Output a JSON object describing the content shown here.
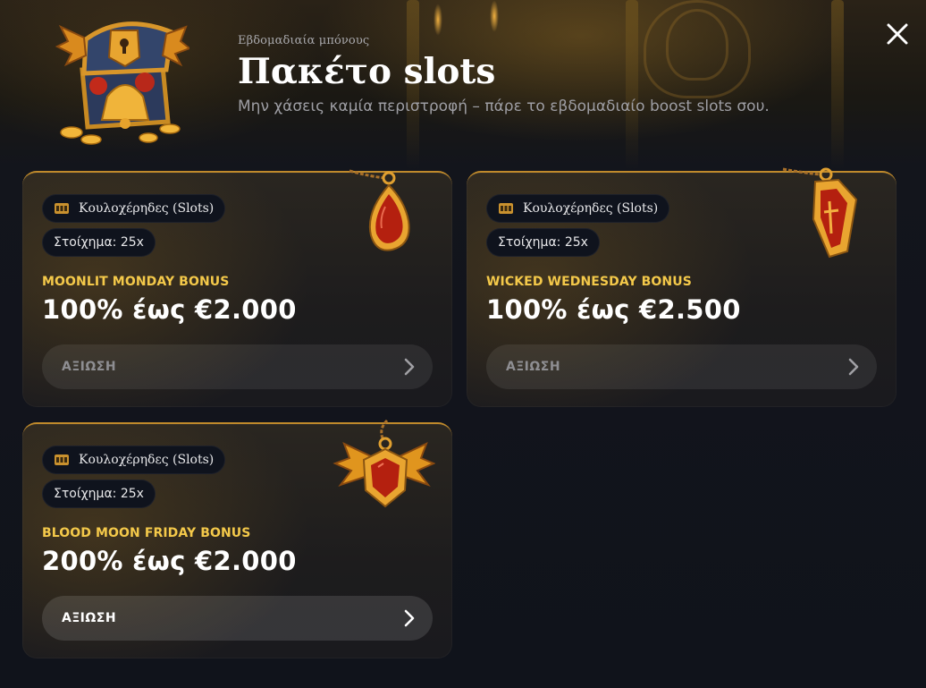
{
  "header": {
    "eyebrow": "Εβδομαδιαία μπόνους",
    "title": "Πακέτο slots",
    "subtitle": "Μην χάσεις καμία περιστροφή – πάρε το εβδομαδιαίο boost slots σου."
  },
  "icons": {
    "close": "close-icon",
    "chest": "treasure-chest-icon",
    "slot": "slot-machine-icon",
    "chevron": "chevron-right-icon"
  },
  "colors": {
    "accent_gold": "#f4c94a",
    "card_border": "#c08a2b",
    "background": "#10131b"
  },
  "cards": [
    {
      "category": "Κουλοχέρηδες (Slots)",
      "wager": "Στοίχημα: 25x",
      "bonus_name": "MOONLIT MONDAY BONUS",
      "amount": "100% έως €2.000",
      "claim_label": "ΑΞΙΩΣΗ",
      "amulet": "teardrop-amulet-icon"
    },
    {
      "category": "Κουλοχέρηδες (Slots)",
      "wager": "Στοίχημα: 25x",
      "bonus_name": "WICKED WEDNESDAY BONUS",
      "amount": "100% έως €2.500",
      "claim_label": "ΑΞΙΩΣΗ",
      "amulet": "coffin-amulet-icon"
    },
    {
      "category": "Κουλοχέρηδες (Slots)",
      "wager": "Στοίχημα: 25x",
      "bonus_name": "BLOOD MOON FRIDAY BONUS",
      "amount": "200% έως €2.000",
      "claim_label": "ΑΞΙΩΣΗ",
      "amulet": "bat-wing-amulet-icon"
    }
  ]
}
